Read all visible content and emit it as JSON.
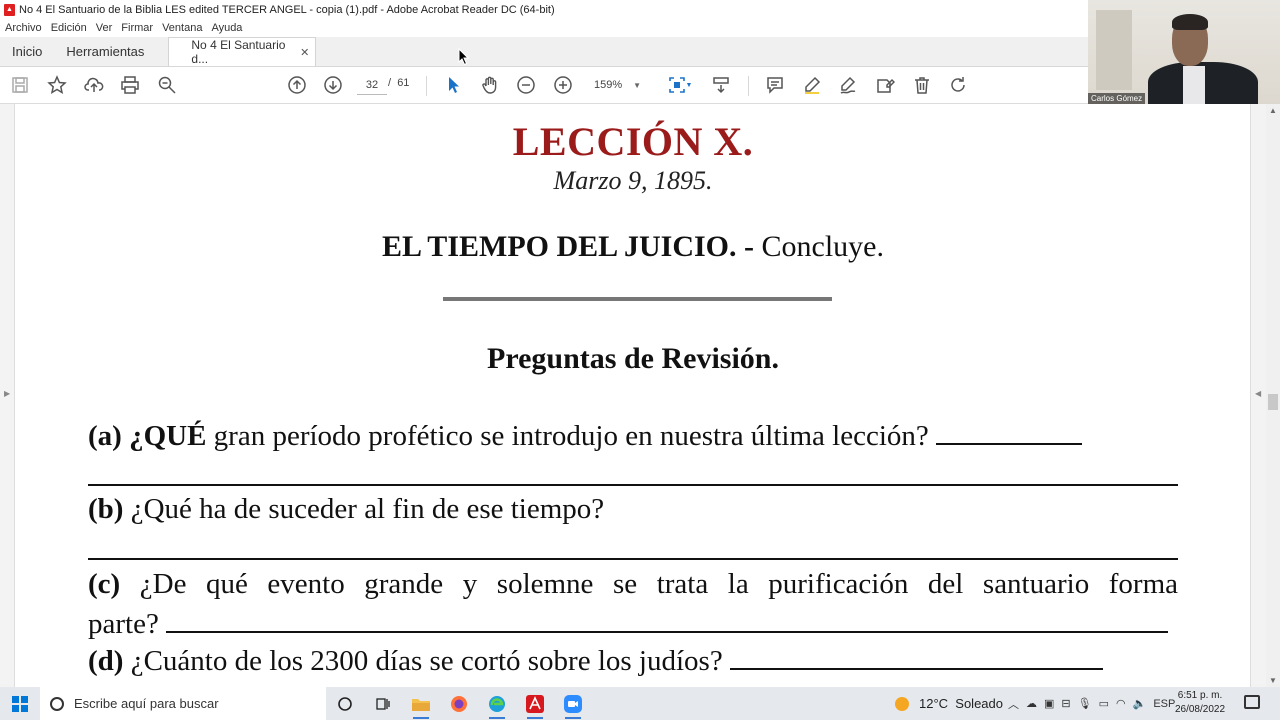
{
  "window": {
    "title": "No 4 El Santuario de la Biblia LES edited TERCER ANGEL - copia (1).pdf - Adobe Acrobat Reader DC (64-bit)"
  },
  "menu": [
    "Archivo",
    "Edición",
    "Ver",
    "Firmar",
    "Ventana",
    "Ayuda"
  ],
  "tabs": {
    "home": "Inicio",
    "tools": "Herramientas",
    "document": "No 4 El Santuario d..."
  },
  "toolbar": {
    "page_current": "32",
    "page_separator": "/",
    "page_total": "61",
    "zoom": "159%"
  },
  "document": {
    "lesson_title": "LECCIÓN X.",
    "date": "Marzo 9, 1895.",
    "heading_bold": "EL TIEMPO DEL JUICIO. -",
    "heading_normal": "Concluye.",
    "review_title": "Preguntas de Revisión.",
    "questions": [
      {
        "label": "(a)",
        "lead": "¿QUÉ",
        "text": "gran período profético se introdujo en nuestra última lección?"
      },
      {
        "label": "(b)",
        "lead": "",
        "text": "¿Qué ha de suceder al fin de ese tiempo?"
      },
      {
        "label": "(c)",
        "lead": "",
        "text": "¿De qué evento grande y solemne se trata la purificación del santuario forma",
        "text2": "parte?"
      },
      {
        "label": "(d)",
        "lead": "",
        "text": "¿Cuánto de los 2300 días se cortó sobre los judíos?"
      }
    ]
  },
  "webcam": {
    "name": "Carlos Gómez"
  },
  "taskbar": {
    "search_placeholder": "Escribe aquí para buscar",
    "weather_temp": "12°C",
    "weather_desc": "Soleado",
    "language": "ESP",
    "time": "6:51 p. m.",
    "date": "26/08/2022"
  },
  "colors": {
    "lesson_title": "#9b1b1b",
    "acrobat_red": "#e02020",
    "taskbar": "#e5e8ec",
    "accent": "#3a7bd5"
  }
}
